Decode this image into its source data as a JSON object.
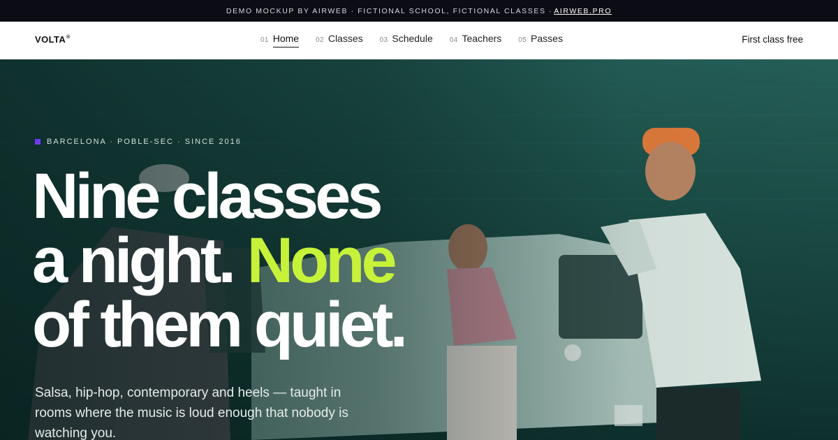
{
  "topbar": {
    "text": "DEMO MOCKUP BY AIRWEB · FICTIONAL SCHOOL, FICTIONAL CLASSES ·",
    "link": "AIRWEB.PRO"
  },
  "nav": {
    "logo": "VOLTA",
    "logo_mark": "®",
    "items": [
      {
        "num": "01",
        "label": "Home"
      },
      {
        "num": "02",
        "label": "Classes"
      },
      {
        "num": "03",
        "label": "Schedule"
      },
      {
        "num": "04",
        "label": "Teachers"
      },
      {
        "num": "05",
        "label": "Passes"
      }
    ],
    "active_item": "Home",
    "cta": "First class free"
  },
  "hero": {
    "eyebrow": "BARCELONA · POBLE-SEC · SINCE 2016",
    "headline": {
      "line1": "Nine classes",
      "line2a": "a night.",
      "line2b": "None",
      "line3": "of them quiet."
    },
    "subtitle": "Salsa, hip-hop, contemporary and heels — taught in rooms where the music is loud enough that nobody is watching you."
  },
  "colors": {
    "accent_lime": "#c7f23a",
    "accent_purple": "#6e3bf0",
    "hero_teal": "#123f3b",
    "topbar_bg": "#0c0c14"
  }
}
